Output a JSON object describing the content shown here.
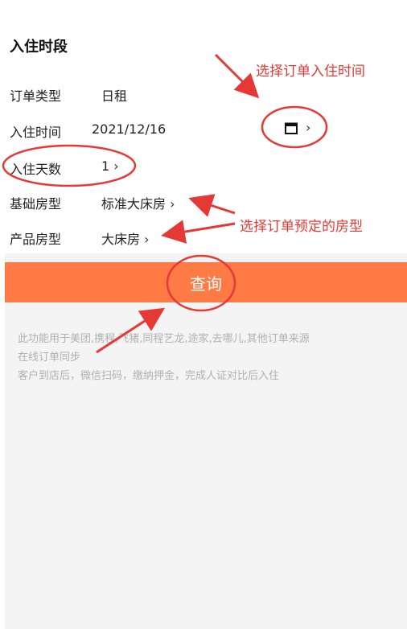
{
  "section": {
    "title": "入住时段"
  },
  "rows": {
    "order_type": {
      "label": "订单类型",
      "value": "日租"
    },
    "checkin_time": {
      "label": "入住时间",
      "value": "2021/12/16"
    },
    "stay_days": {
      "label": "入住天数",
      "value": "1"
    },
    "base_room": {
      "label": "基础房型",
      "value": "标准大床房"
    },
    "product_room": {
      "label": "产品房型",
      "value": "大床房"
    }
  },
  "chevron": "›",
  "query_button": {
    "label": "查询"
  },
  "info": {
    "line1": "此功能用于美团,携程,飞猪,同程艺龙,途家,去哪儿,其他订单来源",
    "line2": "在线订单同步",
    "line3": "客户到店后，微信扫码，缴纳押金，完成人证对比后入住"
  },
  "annotations": {
    "checkin_hint": "选择订单入住时间",
    "room_hint": "选择订单预定的房型"
  },
  "colors": {
    "accent": "#ff7a45",
    "annotation": "#e53935"
  },
  "icons": {
    "date": "calendar-icon"
  }
}
